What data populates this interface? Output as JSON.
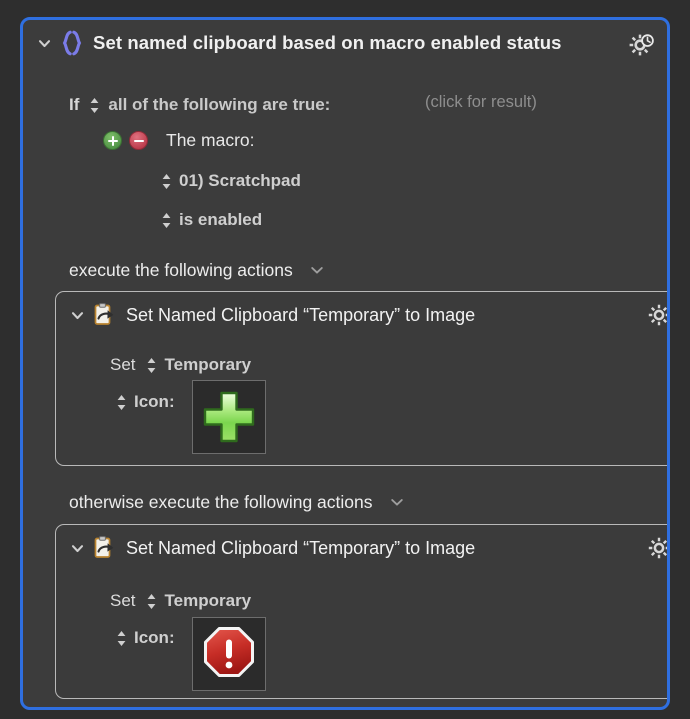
{
  "window": {
    "background_color": "#2e2e2e",
    "panel_color": "#3c3c3c",
    "focus_border_color": "#2f6fe0"
  },
  "if_action": {
    "disclosure_icon": "chevron-down-icon",
    "type_icon": "curly-braces-icon",
    "title": "Set named clipboard based on macro enabled status",
    "gear_icon": "gear-clock-icon",
    "condition": {
      "if_label": "If",
      "match_selector": "all of the following are true:",
      "result_hint": "(click for result)",
      "add_button_icon": "plus-circle-icon",
      "remove_button_icon": "minus-circle-icon",
      "condition_type": "The macro:",
      "macro_name": "01) Scratchpad",
      "macro_state": "is enabled"
    },
    "then_label": "execute the following actions",
    "else_label": "otherwise execute the following actions"
  },
  "then_action": {
    "disclosure_icon": "chevron-down-icon",
    "type_icon": "clipboard-arrow-icon",
    "title": "Set Named Clipboard “Temporary” to Image",
    "gear_icon": "gear-icon",
    "set_label": "Set",
    "clipboard_name": "Temporary",
    "icon_label": "Icon:",
    "image_name": "green-plus-image",
    "image_colors": {
      "fill_light": "#d8f5bb",
      "fill_dark": "#57c03a",
      "stroke": "#2f7a22"
    }
  },
  "else_action": {
    "disclosure_icon": "chevron-down-icon",
    "type_icon": "clipboard-arrow-icon",
    "title": "Set Named Clipboard “Temporary” to Image",
    "gear_icon": "gear-icon",
    "set_label": "Set",
    "clipboard_name": "Temporary",
    "icon_label": "Icon:",
    "image_name": "red-stop-sign-image",
    "image_colors": {
      "fill_light": "#e0453f",
      "fill_dark": "#9c1714",
      "stroke": "#ffffff"
    }
  }
}
